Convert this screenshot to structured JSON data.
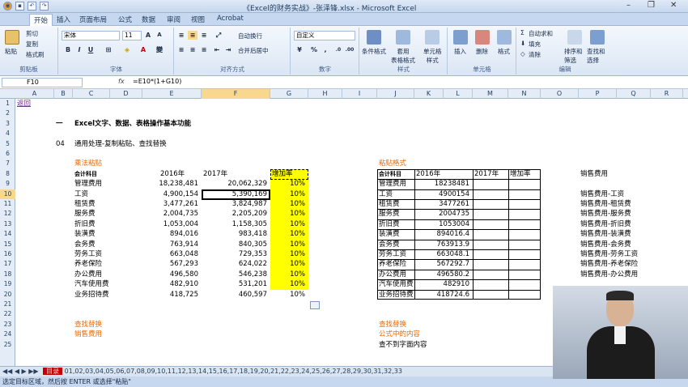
{
  "window": {
    "title": "《Excel的财务实战》-张泽锋.xlsx - Microsoft Excel"
  },
  "ribbon_tabs": [
    "开始",
    "插入",
    "页面布局",
    "公式",
    "数据",
    "审阅",
    "视图",
    "Acrobat"
  ],
  "ribbon": {
    "paste": "粘贴",
    "cut": "剪切",
    "copy": "复制",
    "format_painter": "格式刷",
    "clipboard_label": "剪贴板",
    "font_name": "宋体",
    "font_size": "11",
    "font_label": "字体",
    "wrap_text": "自动换行",
    "merge_center": "合并后居中",
    "alignment_label": "对齐方式",
    "number_format": "自定义",
    "number_label": "数字",
    "cond_format": "条件格式",
    "table_format": "套用\n表格格式",
    "cell_style": "单元格\n样式",
    "style_label": "样式",
    "insert": "插入",
    "delete": "删除",
    "format": "格式",
    "cells_label": "单元格",
    "autosum": "自动求和",
    "fill": "填充",
    "clear": "清除",
    "sort_filter": "排序和\n筛选",
    "find_select": "查找和\n选择",
    "editing_label": "编辑"
  },
  "formula_bar": {
    "name_box": "F10",
    "fx": "fx",
    "formula": "=E10*(1+G10)"
  },
  "columns": [
    "A",
    "B",
    "C",
    "D",
    "E",
    "F",
    "G",
    "H",
    "I",
    "J",
    "K",
    "L",
    "M",
    "N",
    "O",
    "P",
    "Q",
    "R"
  ],
  "rows": [
    "1",
    "2",
    "3",
    "4",
    "5",
    "6",
    "7",
    "8",
    "9",
    "10",
    "11",
    "12",
    "13",
    "14",
    "15",
    "16",
    "17",
    "18",
    "19",
    "20",
    "21",
    "22",
    "23",
    "24",
    "25"
  ],
  "sheet": {
    "back_link": "返回",
    "heading_dash": "一",
    "heading": "Excel文字、数据、表格操作基本功能",
    "sub_num": "04",
    "sub_title": "通用处理-复制粘贴、查找替换",
    "left_section": "乘法粘贴",
    "right_section": "粘贴格式",
    "hdr_account": "会计科目",
    "hdr_2016": "2016年",
    "hdr_2017": "2017年",
    "hdr_rate": "增加率",
    "left_rows": [
      {
        "name": "管理费用",
        "v2016": "18,238,481",
        "v2017": "20,062,329",
        "rate": "10%"
      },
      {
        "name": "工资",
        "v2016": "4,900,154",
        "v2017": "5,390,169",
        "rate": "10%"
      },
      {
        "name": "租赁费",
        "v2016": "3,477,261",
        "v2017": "3,824,987",
        "rate": "10%"
      },
      {
        "name": "服务费",
        "v2016": "2,004,735",
        "v2017": "2,205,209",
        "rate": "10%"
      },
      {
        "name": "折旧费",
        "v2016": "1,053,004",
        "v2017": "1,158,305",
        "rate": "10%"
      },
      {
        "name": "装潢费",
        "v2016": "894,016",
        "v2017": "983,418",
        "rate": "10%"
      },
      {
        "name": "会务费",
        "v2016": "763,914",
        "v2017": "840,305",
        "rate": "10%"
      },
      {
        "name": "劳务工资",
        "v2016": "663,048",
        "v2017": "729,353",
        "rate": "10%"
      },
      {
        "name": "养老保险",
        "v2016": "567,293",
        "v2017": "624,022",
        "rate": "10%"
      },
      {
        "name": "办公费用",
        "v2016": "496,580",
        "v2017": "546,238",
        "rate": "10%"
      },
      {
        "name": "汽车使用费",
        "v2016": "482,910",
        "v2017": "531,201",
        "rate": "10%"
      },
      {
        "name": "业务招待费",
        "v2016": "418,725",
        "v2017": "460,597",
        "rate": "10%"
      }
    ],
    "right_rows": [
      {
        "name": "管理费用",
        "v2016": "18238481"
      },
      {
        "name": "工资",
        "v2016": "4900154"
      },
      {
        "name": "租赁费",
        "v2016": "3477261"
      },
      {
        "name": "服务费",
        "v2016": "2004735"
      },
      {
        "name": "折旧费",
        "v2016": "1053004"
      },
      {
        "name": "装潢费",
        "v2016": "894016.4"
      },
      {
        "name": "会务费",
        "v2016": "763913.9"
      },
      {
        "name": "劳务工资",
        "v2016": "663048.1"
      },
      {
        "name": "养老保险",
        "v2016": "567292.7"
      },
      {
        "name": "办公费用",
        "v2016": "496580.2"
      },
      {
        "name": "汽车使用费",
        "v2016": "482910"
      },
      {
        "name": "业务招待费",
        "v2016": "418724.6"
      }
    ],
    "p_col": [
      "销售费用",
      "",
      "销售费用-工资",
      "销售费用-租赁费",
      "销售费用-服务费",
      "销售费用-折旧费",
      "销售费用-装潢费",
      "销售费用-会务费",
      "销售费用-劳务工资",
      "销售费用-养老保险",
      "销售费用-办公费用"
    ],
    "left_find": "查找替换",
    "left_find_sub": "销售费用",
    "right_find": "查找替换",
    "right_find_sub": "公式中的内容",
    "right_find_sub2": "查不到字面内容"
  },
  "sheet_tabs": "01,02,03,04,05,06,07,08,09,10,11,12,13,14,15,16,17,18,19,20,21,22,23,24,25,26,27,28,29,30,31,32,33",
  "status": "选定目标区域，然后按 ENTER 或选择\"粘贴\""
}
